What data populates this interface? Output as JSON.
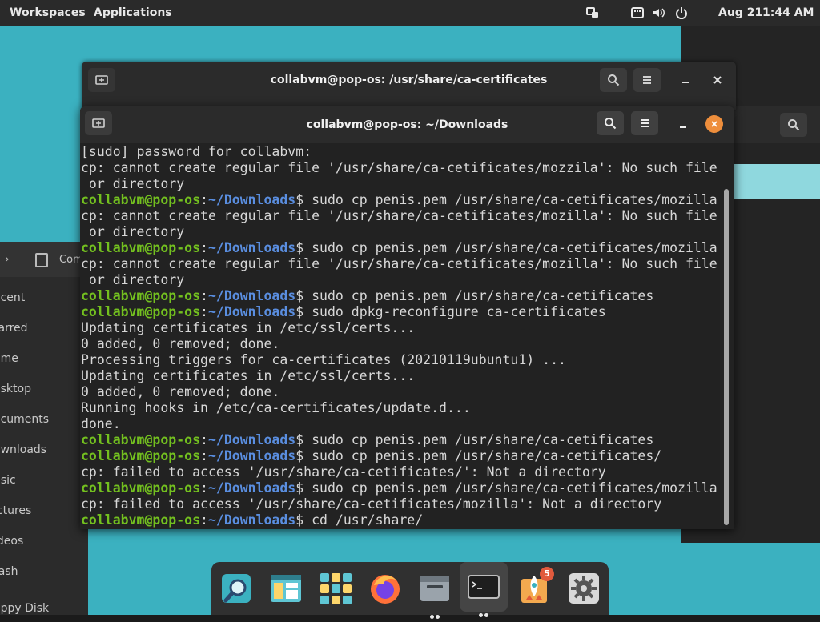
{
  "topbar": {
    "workspaces": "Workspaces",
    "applications": "Applications",
    "date": "Aug 21",
    "time": "1:44 AM"
  },
  "files_window": {
    "header_label": "Com",
    "sidebar": [
      "ecent",
      "tarred",
      "ome",
      "esktop",
      "ocuments",
      "ownloads",
      "usic",
      "ictures",
      "ideos",
      "rash",
      "oppy Disk"
    ]
  },
  "back_terminal": {
    "title": "collabvm@pop-os: /usr/share/ca-certificates"
  },
  "front_terminal": {
    "title": "collabvm@pop-os: ~/Downloads",
    "prompt_user": "collabvm@pop-os",
    "prompt_path": "~/Downloads",
    "lines": [
      {
        "t": "out",
        "text": "[sudo] password for collabvm:"
      },
      {
        "t": "out",
        "text": "cp: cannot create regular file '/usr/share/ca-cetificates/mozzila': No such file"
      },
      {
        "t": "out",
        "text": " or directory"
      },
      {
        "t": "cmd",
        "text": "$ sudo cp penis.pem /usr/share/ca-cetificates/mozilla"
      },
      {
        "t": "out",
        "text": "cp: cannot create regular file '/usr/share/ca-cetificates/mozilla': No such file"
      },
      {
        "t": "out",
        "text": " or directory"
      },
      {
        "t": "cmd",
        "text": "$ sudo cp penis.pem /usr/share/ca-cetificates/mozilla"
      },
      {
        "t": "out",
        "text": "cp: cannot create regular file '/usr/share/ca-cetificates/mozilla': No such file"
      },
      {
        "t": "out",
        "text": " or directory"
      },
      {
        "t": "cmd",
        "text": "$ sudo cp penis.pem /usr/share/ca-cetificates"
      },
      {
        "t": "cmd",
        "text": "$ sudo dpkg-reconfigure ca-certificates"
      },
      {
        "t": "out",
        "text": "Updating certificates in /etc/ssl/certs..."
      },
      {
        "t": "out",
        "text": "0 added, 0 removed; done."
      },
      {
        "t": "out",
        "text": "Processing triggers for ca-certificates (20210119ubuntu1) ..."
      },
      {
        "t": "out",
        "text": "Updating certificates in /etc/ssl/certs..."
      },
      {
        "t": "out",
        "text": "0 added, 0 removed; done."
      },
      {
        "t": "out",
        "text": "Running hooks in /etc/ca-certificates/update.d..."
      },
      {
        "t": "out",
        "text": "done."
      },
      {
        "t": "cmd",
        "text": "$ sudo cp penis.pem /usr/share/ca-cetificates"
      },
      {
        "t": "cmd",
        "text": "$ sudo cp penis.pem /usr/share/ca-cetificates/"
      },
      {
        "t": "out",
        "text": "cp: failed to access '/usr/share/ca-cetificates/': Not a directory"
      },
      {
        "t": "cmd",
        "text": "$ sudo cp penis.pem /usr/share/ca-cetificates/mozilla"
      },
      {
        "t": "out",
        "text": "cp: failed to access '/usr/share/ca-cetificates/mozilla': Not a directory"
      },
      {
        "t": "cmd",
        "text": "$ cd /usr/share/"
      }
    ]
  },
  "dock": {
    "items": [
      {
        "name": "search-app",
        "icon": "magnifier-icon"
      },
      {
        "name": "files-app",
        "icon": "file-manager-icon"
      },
      {
        "name": "app-grid",
        "icon": "grid-icon"
      },
      {
        "name": "firefox",
        "icon": "firefox-icon"
      },
      {
        "name": "files-running",
        "icon": "folder-icon"
      },
      {
        "name": "terminal",
        "icon": "terminal-icon"
      },
      {
        "name": "pop-shop",
        "icon": "rocket-icon",
        "badge": "5"
      },
      {
        "name": "settings",
        "icon": "gear-icon"
      }
    ]
  },
  "colors": {
    "wallpaper": "#3bb1c0",
    "prompt_user": "#73c01f",
    "prompt_path": "#5a8ee0",
    "close_button": "#ee8e3c"
  }
}
